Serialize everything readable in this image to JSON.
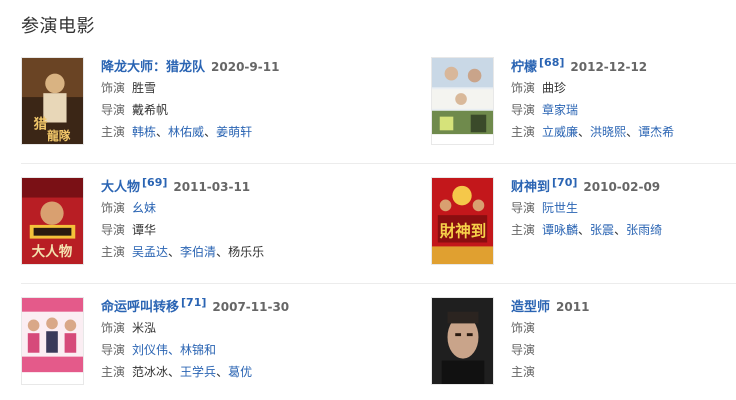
{
  "section_title": "参演电影",
  "labels": {
    "role": "饰演",
    "director": "导演",
    "cast": "主演",
    "sep": "、"
  },
  "movies": [
    {
      "title": "降龙大师：猎龙队",
      "score": "",
      "date": "2020-9-11",
      "role": "胜雪",
      "director": "戴希帆",
      "cast": [
        "韩栋",
        "林佑威",
        "姜萌轩"
      ],
      "poster_colors": [
        "#5a3a22",
        "#c99a5a",
        "#e8c78a"
      ]
    },
    {
      "title": "柠檬",
      "score": "[68]",
      "date": "2012-12-12",
      "role": "曲珍",
      "director": "章家瑞",
      "cast": [
        "立威廉",
        "洪晓熙",
        "谭杰希"
      ],
      "poster_colors": [
        "#dfe6ee",
        "#8aa6c4",
        "#4d6a3c"
      ]
    },
    {
      "title": "大人物",
      "score": "[69]",
      "date": "2011-03-11",
      "role": "幺妹",
      "director": "谭华",
      "cast": [
        "吴孟达",
        "李伯清",
        "杨乐乐"
      ],
      "poster_colors": [
        "#c8232a",
        "#f5c33a",
        "#3a2a1a"
      ]
    },
    {
      "title": "财神到",
      "score": "[70]",
      "date": "2010-02-09",
      "role": "",
      "director": "阮世生",
      "cast": [
        "谭咏麟",
        "张震",
        "张雨绮"
      ],
      "poster_colors": [
        "#c41a1a",
        "#f6d24a",
        "#7a1010"
      ]
    },
    {
      "title": "命运呼叫转移",
      "score": "[71]",
      "date": "2007-11-30",
      "role": "米泓",
      "director": "刘仪伟、林锦和",
      "cast": [
        "范冰冰",
        "王学兵",
        "葛优"
      ],
      "poster_colors": [
        "#f3d3de",
        "#d64a7a",
        "#ffffff"
      ]
    },
    {
      "title": "造型师",
      "score": "",
      "date": "2011",
      "role": "",
      "director": "",
      "cast": [],
      "poster_colors": [
        "#2a2a2a",
        "#c9a48a",
        "#6a4a3a"
      ]
    }
  ]
}
